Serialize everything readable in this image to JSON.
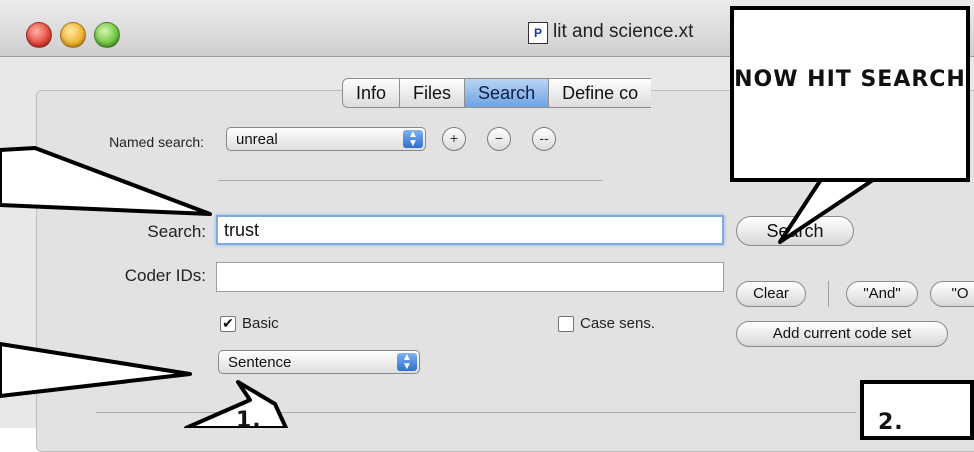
{
  "window": {
    "title": "lit and science.xt",
    "doc_icon": "P"
  },
  "tabs": [
    {
      "label": "Info",
      "active": false
    },
    {
      "label": "Files",
      "active": false
    },
    {
      "label": "Search",
      "active": true
    },
    {
      "label": "Define co",
      "active": false
    }
  ],
  "named_search": {
    "label": "Named search:",
    "value": "unreal",
    "add_label": "+",
    "remove_label": "−",
    "remove_all_label": "--"
  },
  "search": {
    "label": "Search:",
    "value": "trust",
    "button_label": "Search"
  },
  "coder_ids": {
    "label": "Coder IDs:",
    "value": ""
  },
  "options": {
    "basic_label": "Basic",
    "basic_checked": true,
    "case_label": "Case sens.",
    "case_checked": false,
    "scope_value": "Sentence"
  },
  "code_buttons": {
    "clear": "Clear",
    "and": "\"And\"",
    "or": "\"O",
    "add_current": "Add current code set"
  },
  "callouts": {
    "top_right": "NOW HIT SEARCH",
    "bottom_center": "1.",
    "bottom_right": "2."
  },
  "icons": {
    "stepper_arrows": "⬍",
    "checkmark": "✔"
  }
}
